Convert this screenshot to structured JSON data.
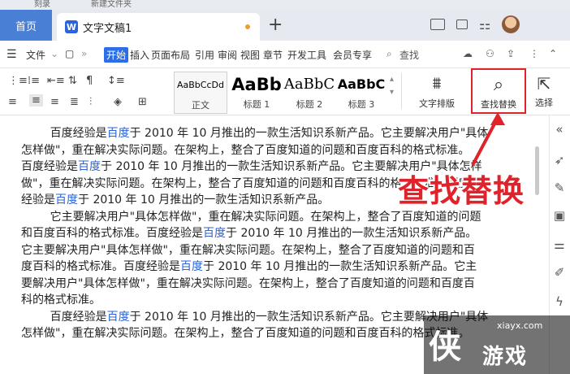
{
  "top_strip": {
    "left": "刻录",
    "right": "新建文件夹"
  },
  "tabs": {
    "home": "首页",
    "doc_title": "文字文稿1",
    "plus": "+"
  },
  "menu": {
    "file": "文件",
    "items": [
      "开始",
      "插入",
      "页面布局",
      "引用",
      "审阅",
      "视图",
      "章节",
      "开发工具",
      "会员专享"
    ],
    "search": "查找"
  },
  "ribbon": {
    "styles": [
      {
        "sample": "AaBbCcDd",
        "caption": "正文"
      },
      {
        "sample": "AaBb",
        "caption": "标题 1"
      },
      {
        "sample": "AaBbC",
        "caption": "标题 2"
      },
      {
        "sample": "AaBbC",
        "caption": "标题 3"
      }
    ],
    "text_layout": "文字排版",
    "find_replace": "查找替换",
    "select": "选择"
  },
  "annotation": "查找替换",
  "document": {
    "paragraphs": [
      [
        "        百度经验是",
        "百度",
        "于 2010 年 10 月推出的一款生活知识系新产品。它主要解决用户\"具体"
      ],
      [
        "怎样做\"，重在解决实际问题。在架构上，整合了百度知道的问题和百度百科的格式标准。",
        "",
        ""
      ],
      [
        "百度经验是",
        "百度",
        "于 2010 年 10 月推出的一款生活知识系新产品。它主要解决用户\"具体怎样"
      ],
      [
        "做\"，重在解决实际问题。在架构上，整合了百度知道的问题和百度百科的格式标准。百度",
        "",
        ""
      ],
      [
        "经验是",
        "百度",
        "于 2010 年 10 月推出的一款生活知识系新产品。"
      ],
      [
        "        它主要解决用户\"具体怎样做\"，重在解决实际问题。在架构上，整合了百度知道的问题",
        "",
        ""
      ],
      [
        "和百度百科的格式标准。百度经验是",
        "百度",
        "于 2010 年 10 月推出的一款生活知识系新产品。"
      ],
      [
        "它主要解决用户\"具体怎样做\"，重在解决实际问题。在架构上，整合了百度知道的问题和百",
        "",
        ""
      ],
      [
        "度百科的格式标准。百度经验是",
        "百度",
        "于 2010 年 10 月推出的一款生活知识系新产品。它主"
      ],
      [
        "要解决用户\"具体怎样做\"，重在解决实际问题。在架构上，整合了百度知道的问题和百度百",
        "",
        ""
      ],
      [
        "科的格式标准。",
        "",
        ""
      ],
      [
        "        百度经验是",
        "百度",
        "于 2010 年 10 月推出的一款生活知识系新产品。它主要解决用户\"具体"
      ],
      [
        "怎样做\"，重在解决实际问题。在架构上，整合了百度知道的问题和百度百科的格式标准。",
        "",
        ""
      ]
    ]
  },
  "watermark": {
    "logo": "侠",
    "site": "xiayx.com",
    "name": "游戏"
  },
  "colors": {
    "accent": "#2b6ee8",
    "annotation_red": "#e0222a",
    "home_tab": "#4a7fd6"
  }
}
